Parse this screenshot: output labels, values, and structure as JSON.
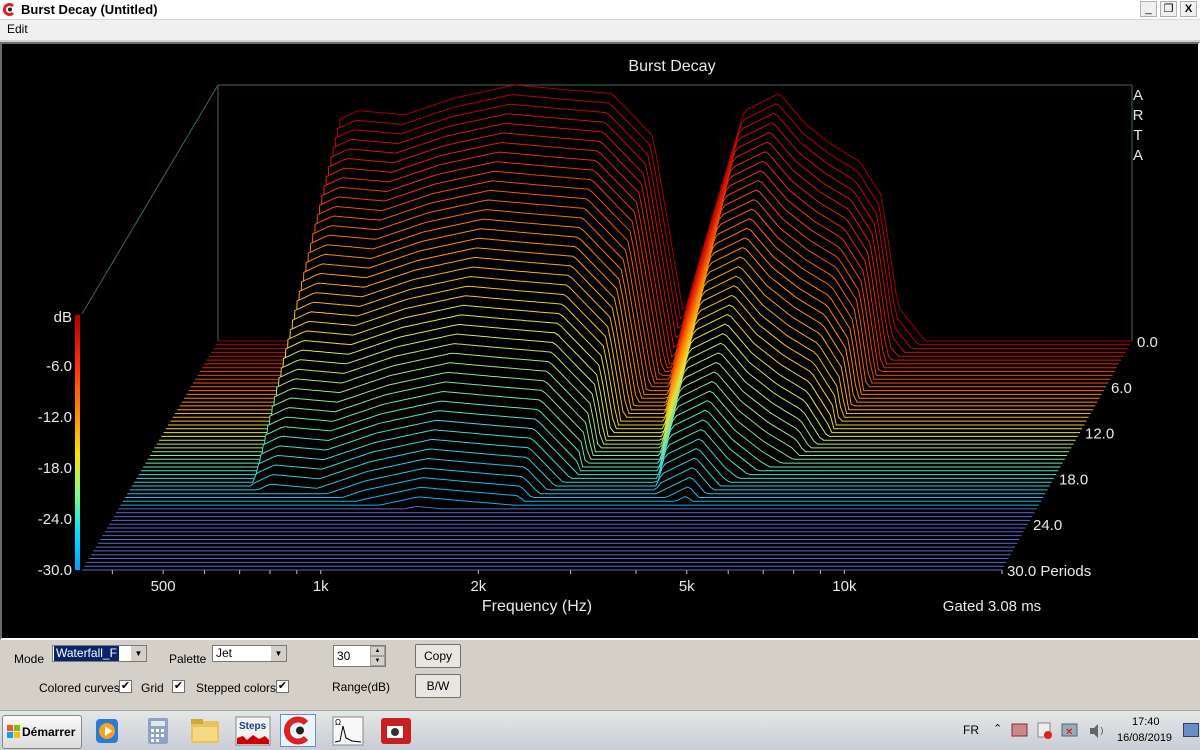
{
  "window": {
    "title": "Burst Decay  (Untitled)",
    "minimize": "_",
    "restore": "❐",
    "close": "X"
  },
  "menu": {
    "edit": "Edit"
  },
  "chart_data": {
    "type": "waterfall",
    "title": "Burst Decay",
    "watermark": "ARTA",
    "xlabel": "Frequency (Hz)",
    "x_scale": "log",
    "xlim": [
      350,
      20000
    ],
    "x_ticks": [
      "500",
      "1k",
      "2k",
      "5k",
      "10k"
    ],
    "zlabel": "dB",
    "zlim": [
      -30,
      0
    ],
    "z_ticks": [
      "-6.0",
      "-12.0",
      "-18.0",
      "-24.0",
      "-30.0"
    ],
    "right_ticks": [
      "0.0",
      "6.0",
      "12.0",
      "18.0",
      "24.0",
      "30.0 Periods"
    ],
    "ylabel": "Periods",
    "ylim": [
      0,
      30
    ],
    "note": "Gated 3.08 ms",
    "palette": "Jet",
    "grid": true,
    "stepped_colors": true,
    "colored_curves": true,
    "series": [
      {
        "name": "0 periods",
        "points": [
          [
            600,
            -4
          ],
          [
            650,
            -3
          ],
          [
            800,
            -3.5
          ],
          [
            1000,
            -1.5
          ],
          [
            1300,
            0
          ],
          [
            1600,
            -0.5
          ],
          [
            2000,
            -1
          ],
          [
            2400,
            -6
          ],
          [
            2750,
            -27
          ],
          [
            3100,
            -16
          ],
          [
            3600,
            -3
          ],
          [
            4200,
            -1
          ],
          [
            4700,
            -4.5
          ],
          [
            5300,
            -7
          ],
          [
            6000,
            -9
          ],
          [
            6600,
            -13
          ],
          [
            7100,
            -26
          ],
          [
            8000,
            -30
          ],
          [
            20000,
            -30
          ]
        ]
      },
      {
        "name": "30 periods",
        "points": [
          [
            600,
            -30
          ],
          [
            1000,
            -30
          ],
          [
            1500,
            -30
          ],
          [
            2000,
            -30
          ],
          [
            3000,
            -30
          ],
          [
            5000,
            -30
          ],
          [
            10000,
            -30
          ],
          [
            20000,
            -30
          ]
        ]
      }
    ]
  },
  "colors": {
    "background": "#000000",
    "axis": "#c8c8c8",
    "floor": "#5868c8",
    "colorbar": [
      "#ff0000",
      "#ff8000",
      "#ffff00",
      "#00ff80",
      "#00c0ff"
    ]
  },
  "controls": {
    "mode_label": "Mode",
    "mode_value": "Waterfall_F",
    "palette_label": "Palette",
    "palette_value": "Jet",
    "range_value": "30",
    "range_label": "Range(dB)",
    "copy": "Copy",
    "bw": "B/W",
    "colored_curves_label": "Colored curves",
    "colored_curves_checked": true,
    "grid_label": "Grid",
    "grid_checked": true,
    "stepped_colors_label": "Stepped colors",
    "stepped_colors_checked": true
  },
  "taskbar": {
    "start_label": "Démarrer",
    "apps": [
      "media-player-icon",
      "calculator-icon",
      "folder-icon",
      "steps-icon",
      "arta-icon",
      "impedance-icon",
      "video-icon"
    ],
    "steps_label": "Steps",
    "language": "FR",
    "time": "17:40",
    "date": "16/08/2019"
  }
}
